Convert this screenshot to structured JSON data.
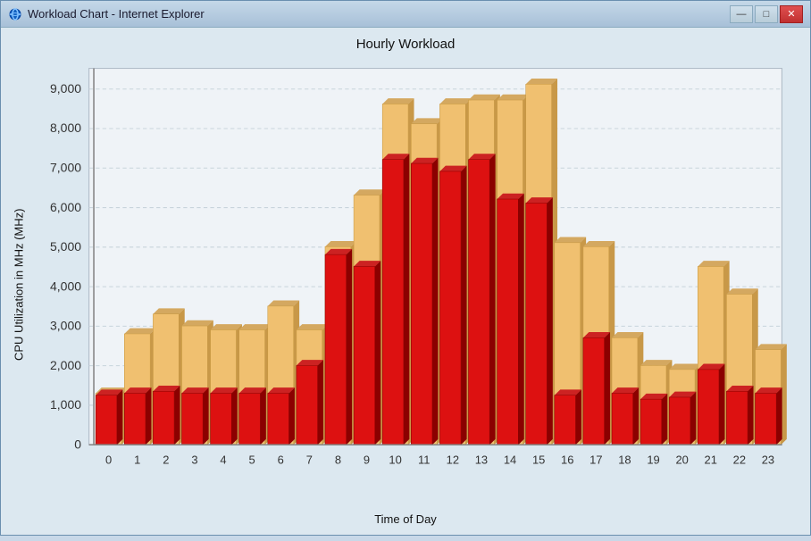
{
  "window": {
    "title": "Workload Chart - Internet Explorer",
    "icon": "ie-icon"
  },
  "titleButtons": {
    "minimize": "—",
    "maximize": "□",
    "close": "✕"
  },
  "chart": {
    "title": "Hourly Workload",
    "yAxisLabel": "CPU Utilization in MHz (MHz)",
    "xAxisLabel": "Time of Day",
    "yTicks": [
      "9,000",
      "8,000",
      "7,000",
      "6,000",
      "5,000",
      "4,000",
      "3,000",
      "2,000",
      "1,000",
      "0"
    ],
    "xTicks": [
      "0",
      "1",
      "2",
      "3",
      "4",
      "5",
      "6",
      "7",
      "8",
      "9",
      "10",
      "11",
      "12",
      "13",
      "14",
      "15",
      "16",
      "17",
      "18",
      "19",
      "20",
      "21",
      "22",
      "23"
    ],
    "yMin": 0,
    "yMax": 9500,
    "colors": {
      "back": "#f0c080",
      "front": "#cc1111",
      "frontDark": "#8b0000",
      "backDark": "#c89040"
    },
    "bars": [
      {
        "hour": 0,
        "back": 1300,
        "front": 1250
      },
      {
        "hour": 1,
        "back": 2800,
        "front": 1300
      },
      {
        "hour": 2,
        "back": 3300,
        "front": 1350
      },
      {
        "hour": 3,
        "back": 3000,
        "front": 1300
      },
      {
        "hour": 4,
        "back": 2900,
        "front": 1300
      },
      {
        "hour": 5,
        "back": 2900,
        "front": 1300
      },
      {
        "hour": 6,
        "back": 3500,
        "front": 1300
      },
      {
        "hour": 7,
        "back": 2900,
        "front": 2000
      },
      {
        "hour": 8,
        "back": 5000,
        "front": 4800
      },
      {
        "hour": 9,
        "back": 6300,
        "front": 4500
      },
      {
        "hour": 10,
        "back": 8600,
        "front": 7200
      },
      {
        "hour": 11,
        "back": 8100,
        "front": 7100
      },
      {
        "hour": 12,
        "back": 8600,
        "front": 6900
      },
      {
        "hour": 13,
        "back": 8700,
        "front": 7200
      },
      {
        "hour": 14,
        "back": 8700,
        "front": 6200
      },
      {
        "hour": 15,
        "back": 9100,
        "front": 6100
      },
      {
        "hour": 16,
        "back": 5100,
        "front": 1250
      },
      {
        "hour": 17,
        "back": 5000,
        "front": 2700
      },
      {
        "hour": 18,
        "back": 2700,
        "front": 1300
      },
      {
        "hour": 19,
        "back": 2000,
        "front": 1150
      },
      {
        "hour": 20,
        "back": 1900,
        "front": 1200
      },
      {
        "hour": 21,
        "back": 4500,
        "front": 1900
      },
      {
        "hour": 22,
        "back": 3800,
        "front": 1350
      },
      {
        "hour": 23,
        "back": 2400,
        "front": 1300
      }
    ]
  }
}
